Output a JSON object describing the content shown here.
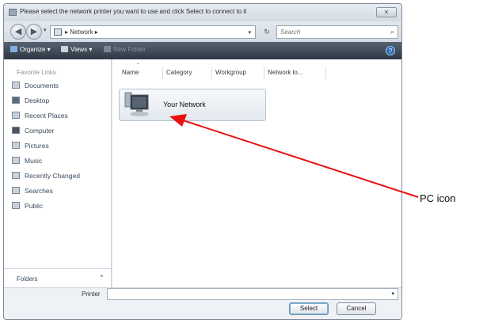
{
  "window": {
    "title": "Please select the network printer you want to use and click Select to connect to it",
    "close_label": "✕"
  },
  "address": {
    "breadcrumb": "▸ Network ▸",
    "search_placeholder": "Search"
  },
  "toolbar": {
    "organize": "Organize ▾",
    "views": "Views ▾",
    "new_folder": "New Folder"
  },
  "nav": {
    "heading": "Favorite Links",
    "items": [
      {
        "label": "Documents",
        "icon": "documents-icon"
      },
      {
        "label": "Desktop",
        "icon": "desktop-icon"
      },
      {
        "label": "Recent Places",
        "icon": "recent-places-icon"
      },
      {
        "label": "Computer",
        "icon": "computer-icon"
      },
      {
        "label": "Pictures",
        "icon": "pictures-icon"
      },
      {
        "label": "Music",
        "icon": "music-icon"
      },
      {
        "label": "Recently Changed",
        "icon": "recently-changed-icon"
      },
      {
        "label": "Searches",
        "icon": "searches-icon"
      },
      {
        "label": "Public",
        "icon": "public-icon"
      }
    ],
    "folders_label": "Folders"
  },
  "columns": [
    "Name",
    "Category",
    "Workgroup",
    "Network lo..."
  ],
  "items": [
    {
      "label": "Your Network",
      "icon": "pc-icon"
    }
  ],
  "bottom": {
    "printer_label": "Printer",
    "printer_value": "",
    "select_label": "Select",
    "cancel_label": "Cancel"
  },
  "annotation": {
    "callout": "PC icon",
    "arrow_color": "#e8110f"
  },
  "colors": {
    "toolbar_bg": "#2d3844",
    "selection_border": "#6fb6e8"
  }
}
